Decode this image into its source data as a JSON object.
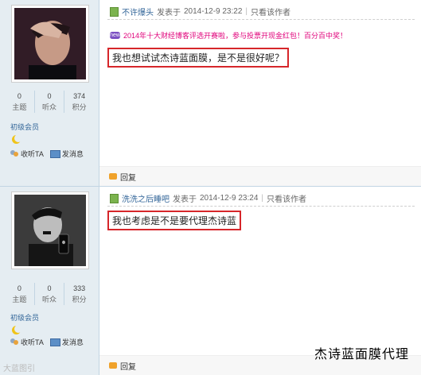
{
  "posts": [
    {
      "author": "不许爆头",
      "posted_label": "发表于",
      "datetime": "2014-12-9 23:22",
      "only_author": "只看该作者",
      "promo": "2014年十大财经博客评选开赛啦，参与投票开现金红包！百分百中奖！",
      "promo_tag": "new",
      "content": "我也想试试杰诗蓝面膜，是不是很好呢？",
      "stats": [
        {
          "num": "0",
          "label": "主题"
        },
        {
          "num": "0",
          "label": "听众"
        },
        {
          "num": "374",
          "label": "积分"
        }
      ],
      "rank": "初级会员",
      "follow": "收听TA",
      "message": "发消息",
      "reply": "回复"
    },
    {
      "author": "洗洗之后睡吧",
      "posted_label": "发表于",
      "datetime": "2014-12-9 23:24",
      "only_author": "只看该作者",
      "content": "我也考虑是不是要代理杰诗蓝",
      "stats": [
        {
          "num": "0",
          "label": "主题"
        },
        {
          "num": "0",
          "label": "听众"
        },
        {
          "num": "333",
          "label": "积分"
        }
      ],
      "rank": "初级会员",
      "follow": "收听TA",
      "message": "发消息",
      "reply": "回复"
    }
  ],
  "watermark": "杰诗蓝面膜代理",
  "corner_watermark": "大蓝图引",
  "colors": {
    "highlight_border": "#d6262a",
    "sidebar_bg": "#e5edf2",
    "link": "#336699",
    "promo": "#e0007a"
  }
}
